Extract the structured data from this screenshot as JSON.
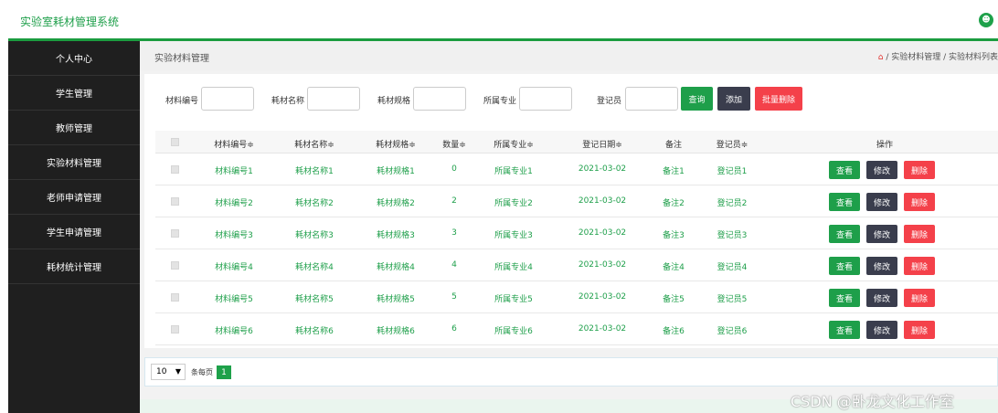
{
  "header": {
    "app_title": "实验室耗材管理系统",
    "user_icon": "user-icon"
  },
  "sidebar": {
    "items": [
      {
        "label": "个人中心"
      },
      {
        "label": "学生管理"
      },
      {
        "label": "教师管理"
      },
      {
        "label": "实验材料管理"
      },
      {
        "label": "老师申请管理"
      },
      {
        "label": "学生申请管理"
      },
      {
        "label": "耗材统计管理"
      }
    ]
  },
  "breadcrumb": {
    "title": "实验材料管理",
    "home_icon": "home-icon",
    "path": " / 实验材料管理 / 实验材料列表"
  },
  "search": {
    "fields": [
      {
        "label": "材料编号",
        "value": ""
      },
      {
        "label": "耗材名称",
        "value": ""
      },
      {
        "label": "耗材规格",
        "value": ""
      },
      {
        "label": "所属专业",
        "value": ""
      },
      {
        "label": "登记员",
        "value": ""
      }
    ],
    "query_label": "查询",
    "add_label": "添加",
    "batch_delete_label": "批量删除"
  },
  "table": {
    "headers": [
      "材料编号≑",
      "耗材名称≑",
      "耗材规格≑",
      "数量≑",
      "所属专业≑",
      "登记日期≑",
      "备注",
      "登记员≑",
      "操作"
    ],
    "rows": [
      [
        "材料编号1",
        "耗材名称1",
        "耗材规格1",
        "0",
        "所属专业1",
        "2021-03-02",
        "备注1",
        "登记员1"
      ],
      [
        "材料编号2",
        "耗材名称2",
        "耗材规格2",
        "2",
        "所属专业2",
        "2021-03-02",
        "备注2",
        "登记员2"
      ],
      [
        "材料编号3",
        "耗材名称3",
        "耗材规格3",
        "3",
        "所属专业3",
        "2021-03-02",
        "备注3",
        "登记员3"
      ],
      [
        "材料编号4",
        "耗材名称4",
        "耗材规格4",
        "4",
        "所属专业4",
        "2021-03-02",
        "备注4",
        "登记员4"
      ],
      [
        "材料编号5",
        "耗材名称5",
        "耗材规格5",
        "5",
        "所属专业5",
        "2021-03-02",
        "备注5",
        "登记员5"
      ],
      [
        "材料编号6",
        "耗材名称6",
        "耗材规格6",
        "6",
        "所属专业6",
        "2021-03-02",
        "备注6",
        "登记员6"
      ]
    ],
    "actions": {
      "view": "查看",
      "edit": "修改",
      "delete": "删除"
    }
  },
  "pagination": {
    "page_size": "10",
    "page_size_label": "条每页",
    "current_page": "1"
  },
  "watermark": "CSDN @卧龙文化工作室",
  "colors": {
    "accent": "#1ea14a",
    "dark_button": "#3a3d4d",
    "danger": "#f4414a",
    "sidebar_bg": "#1f1f1f"
  }
}
